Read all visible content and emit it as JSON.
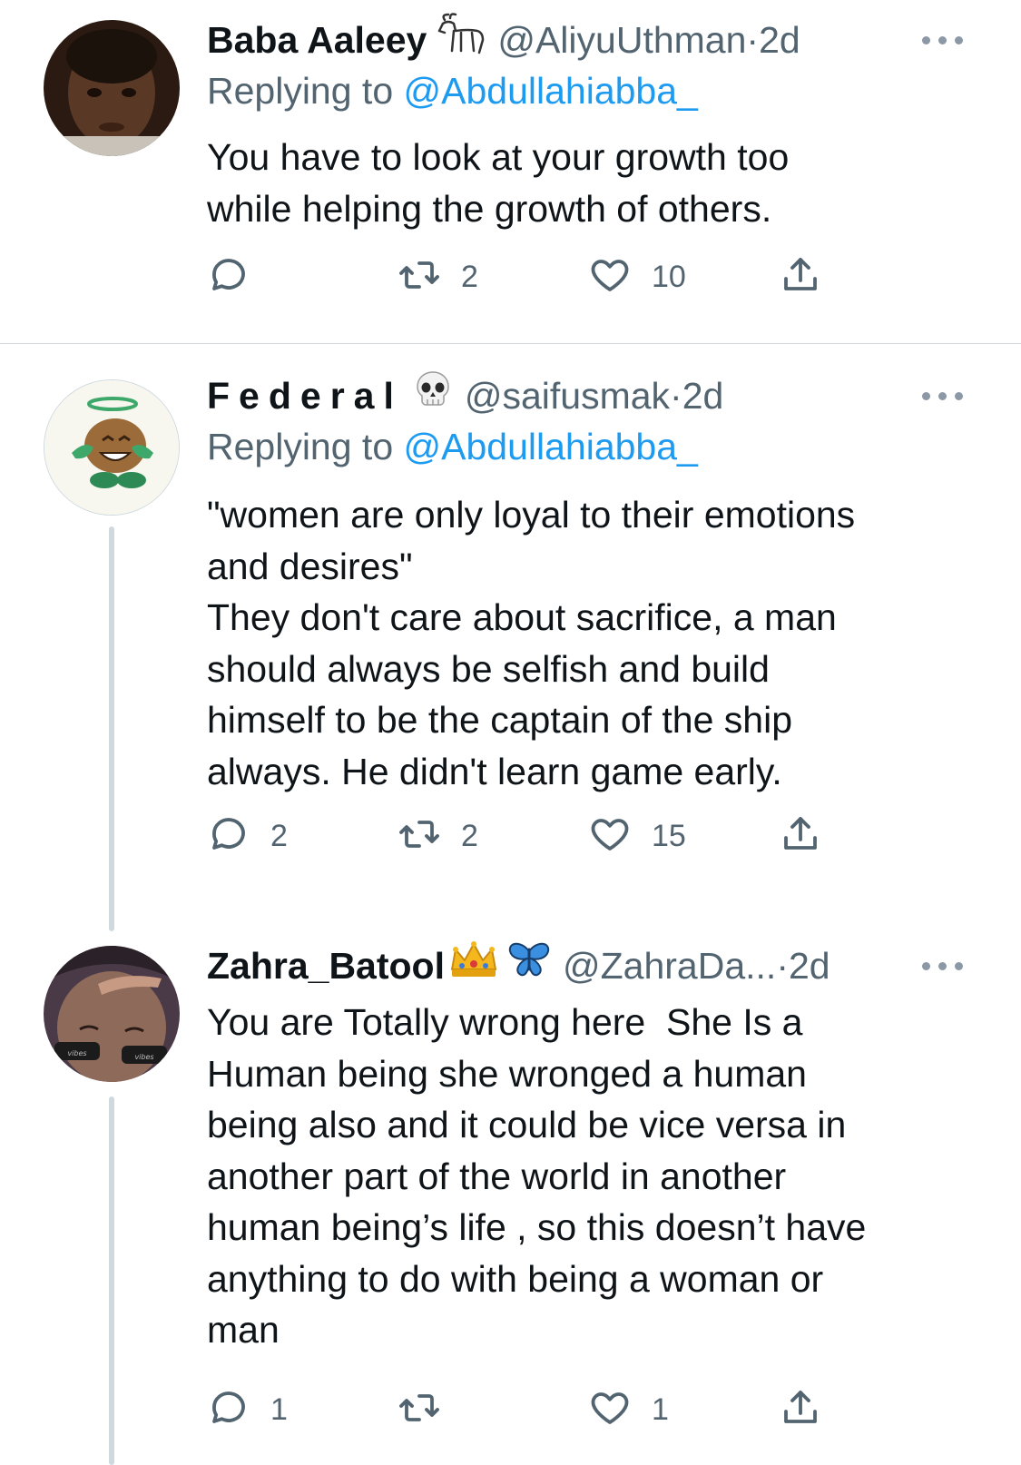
{
  "tweets": [
    {
      "name": "Baba Aaleey",
      "name_emoji": "goat-emoji",
      "handle": "@AliyuUthman",
      "separator": "·",
      "time": "2d",
      "reply_prefix": "Replying to ",
      "reply_mention": "@Abdullahiabba_",
      "text": "You have to look at your growth too\nwhile helping the growth of others.",
      "replies": "",
      "retweets": "2",
      "likes": "10"
    },
    {
      "name": "Federal",
      "name_emoji": "skull-emoji",
      "handle": "@saifusmak",
      "separator": "·",
      "time": "2d",
      "reply_prefix": "Replying to ",
      "reply_mention": "@Abdullahiabba_",
      "text": "\"women are only loyal to their emotions\nand desires\"\nThey don't care about sacrifice, a man\nshould always be selfish and build\nhimself to be the captain of the ship\nalways. He didn't learn game early.",
      "replies": "2",
      "retweets": "2",
      "likes": "15"
    },
    {
      "name": "Zahra_Batool",
      "name_emoji": "crown-butterfly-emoji",
      "handle": "@ZahraDa...",
      "separator": "·",
      "time": "2d",
      "text": "You are Totally wrong here  She Is a\nHuman being she wronged a human\nbeing also and it could be vice versa in\nanother part of the world in another\nhuman being’s life , so this doesn’t have\nanything to do with being a woman or\nman",
      "replies": "1",
      "retweets": "",
      "likes": "1"
    }
  ],
  "colors": {
    "text": "#0f1419",
    "secondary": "#536471",
    "link": "#1d9bf0",
    "thread_line": "#cfd9de"
  }
}
